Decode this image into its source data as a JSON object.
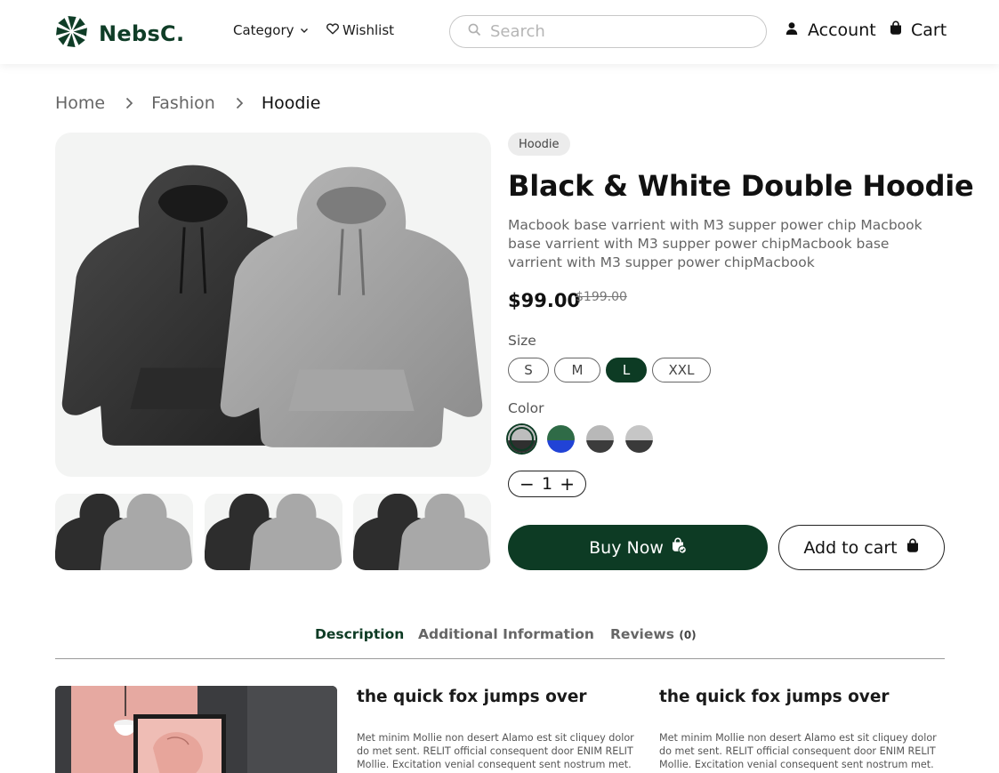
{
  "header": {
    "logo_text": "NebsC.",
    "category_label": "Category",
    "wishlist_label": "Wishlist",
    "search_placeholder": "Search",
    "account_label": "Account",
    "cart_label": "Cart"
  },
  "breadcrumb": {
    "items": [
      "Home",
      "Fashion",
      "Hoodie"
    ]
  },
  "product": {
    "tag": "Hoodie",
    "title": "Black & White Double Hoodie",
    "description": "Macbook base varrient with M3 supper power chip Macbook base varrient with M3 supper power chipMacbook base varrient with M3 supper power chipMacbook",
    "price": "$99.00",
    "old_price": "$199.00",
    "size_label": "Size",
    "sizes": [
      "S",
      "M",
      "L",
      "XXL"
    ],
    "selected_size": "L",
    "color_label": "Color",
    "colors": [
      {
        "name": "white-black",
        "top": "#bdbdbd",
        "bottom": "#2f2f2f",
        "selected": true
      },
      {
        "name": "green-blue",
        "top": "#2f6b47",
        "bottom": "#2143d6",
        "selected": false
      },
      {
        "name": "grey-dark",
        "top": "#b8b8b8",
        "bottom": "#3c3c3c",
        "selected": false
      },
      {
        "name": "grey-darker",
        "top": "#c6c6c6",
        "bottom": "#3a3a3a",
        "selected": false
      }
    ],
    "quantity": "1",
    "buy_now_label": "Buy Now",
    "add_to_cart_label": "Add to cart"
  },
  "tabs": {
    "description": "Description",
    "additional": "Additional Information",
    "reviews": "Reviews",
    "reviews_count": "(0)"
  },
  "content": {
    "col1_title": "the quick fox jumps over",
    "col1_text": "Met minim Mollie non desert Alamo est sit cliquey dolor do met sent. RELIT official consequent door ENIM RELIT Mollie. Excitation venial consequent sent nostrum met.",
    "col2_title": "the quick fox jumps over",
    "col2_text": "Met minim Mollie non desert Alamo est sit cliquey dolor do met sent. RELIT official consequent door ENIM RELIT Mollie. Excitation venial consequent sent nostrum met."
  },
  "icons": {
    "logo": "logo-flower-icon",
    "category_chevron": "chevron-down-icon",
    "wishlist": "heart-icon",
    "search": "search-icon",
    "account": "user-icon",
    "cart": "shopping-bag-icon",
    "breadcrumb_separator": "chevron-right-icon",
    "buy_now": "bag-check-icon",
    "add_to_cart": "shopping-bag-icon"
  },
  "colors": {
    "brand": "#0d3b24",
    "text": "#111111",
    "muted": "#666666"
  }
}
